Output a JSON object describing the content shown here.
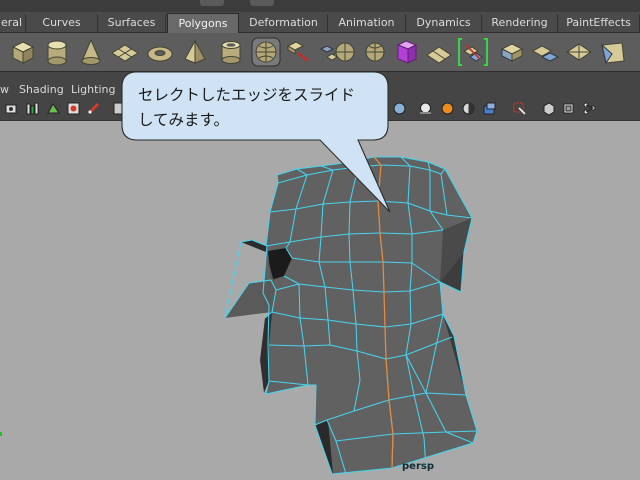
{
  "shelf_tabs": [
    {
      "label": "eral"
    },
    {
      "label": "Curves"
    },
    {
      "label": "Surfaces"
    },
    {
      "label": "Polygons",
      "active": true
    },
    {
      "label": "Deformation"
    },
    {
      "label": "Animation"
    },
    {
      "label": "Dynamics"
    },
    {
      "label": "Rendering"
    },
    {
      "label": "PaintEffects"
    }
  ],
  "shelf_icons": [
    "cube-icon",
    "cylinder-icon",
    "cone-icon",
    "plane-icon",
    "torus-icon",
    "pyramid-icon",
    "pipe-icon",
    "sphere-grid-icon",
    "extrude-icon",
    "combine-icon",
    "separate-icon",
    "smooth-icon",
    "split-edge-icon",
    "append-icon",
    "edge-slide-icon",
    "bevel-icon",
    "merge-icon",
    "poke-icon",
    "wedge-icon"
  ],
  "panel_menu": {
    "items": [
      "w",
      "Shading",
      "Lighting"
    ]
  },
  "viewport": {
    "camera_label": "persp"
  },
  "callout": {
    "line1": "セレクトしたエッジをスライド",
    "line2": "してみます。"
  },
  "colors": {
    "viewport_bg": "#a9a9a9",
    "wire": "#46d4ef",
    "selected_edge": "#e58a3e",
    "balloon_fill": "#cfe3f5"
  }
}
